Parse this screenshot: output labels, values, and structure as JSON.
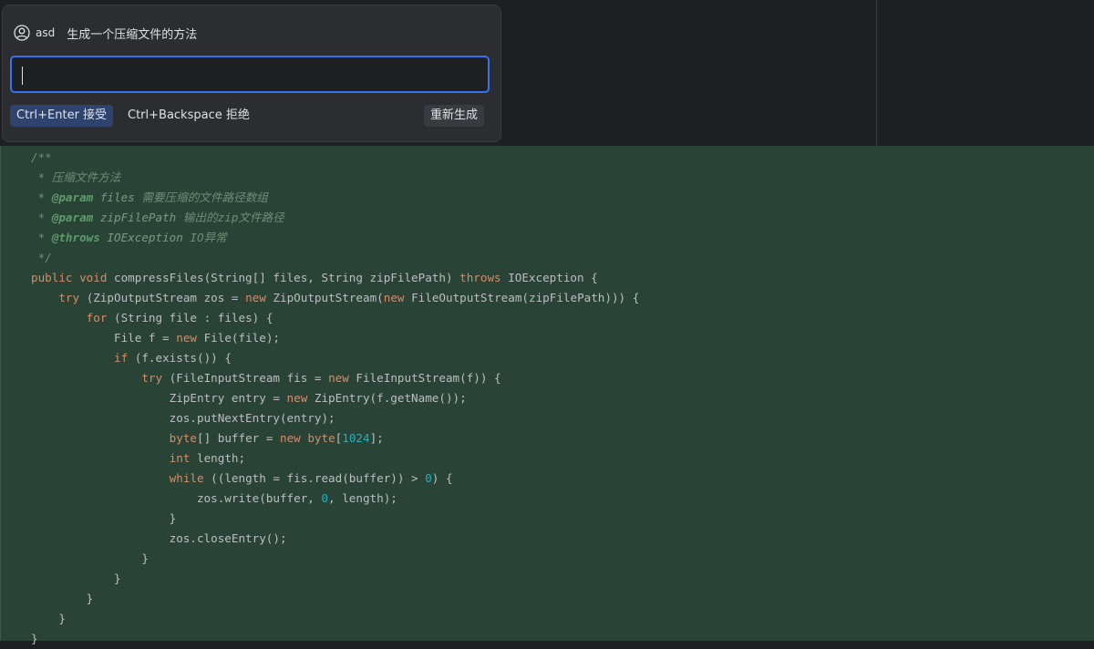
{
  "prompt": {
    "user_name": "asd",
    "text": "生成一个压缩文件的方法"
  },
  "input": {
    "value": "",
    "placeholder": ""
  },
  "actions": {
    "accept_label": "Ctrl+Enter 接受",
    "reject_label": "Ctrl+Backspace 拒绝",
    "regenerate_label": "重新生成"
  },
  "code": {
    "lines": [
      [
        [
          "c-comment",
          "/**"
        ]
      ],
      [
        [
          "c-comment",
          " * 压缩文件方法"
        ]
      ],
      [
        [
          "c-comment",
          " * "
        ],
        [
          "c-tag",
          "@param"
        ],
        [
          "c-param",
          " files "
        ],
        [
          "c-comment",
          "需要压缩的文件路径数组"
        ]
      ],
      [
        [
          "c-comment",
          " * "
        ],
        [
          "c-tag",
          "@param"
        ],
        [
          "c-param",
          " zipFilePath "
        ],
        [
          "c-comment",
          "输出的zip文件路径"
        ]
      ],
      [
        [
          "c-comment",
          " * "
        ],
        [
          "c-tag",
          "@throws"
        ],
        [
          "c-param",
          " IOException "
        ],
        [
          "c-comment",
          "IO异常"
        ]
      ],
      [
        [
          "c-comment",
          " */"
        ]
      ],
      [
        [
          "c-kw",
          "public void "
        ],
        [
          "",
          "compressFiles(String[] files, String zipFilePath) "
        ],
        [
          "c-kw",
          "throws "
        ],
        [
          "",
          "IOException {"
        ]
      ],
      [
        [
          "",
          "    "
        ],
        [
          "c-kw",
          "try "
        ],
        [
          "",
          "(ZipOutputStream zos = "
        ],
        [
          "c-kw",
          "new "
        ],
        [
          "",
          "ZipOutputStream("
        ],
        [
          "c-kw",
          "new "
        ],
        [
          "",
          "FileOutputStream(zipFilePath))) {"
        ]
      ],
      [
        [
          "",
          "        "
        ],
        [
          "c-kw",
          "for "
        ],
        [
          "",
          "(String file : files) {"
        ]
      ],
      [
        [
          "",
          "            File f = "
        ],
        [
          "c-kw",
          "new "
        ],
        [
          "",
          "File(file);"
        ]
      ],
      [
        [
          "",
          "            "
        ],
        [
          "c-kw",
          "if "
        ],
        [
          "",
          "(f.exists()) {"
        ]
      ],
      [
        [
          "",
          "                "
        ],
        [
          "c-kw",
          "try "
        ],
        [
          "",
          "(FileInputStream fis = "
        ],
        [
          "c-kw",
          "new "
        ],
        [
          "",
          "FileInputStream(f)) {"
        ]
      ],
      [
        [
          "",
          "                    ZipEntry entry = "
        ],
        [
          "c-kw",
          "new "
        ],
        [
          "",
          "ZipEntry(f.getName());"
        ]
      ],
      [
        [
          "",
          "                    zos.putNextEntry(entry);"
        ]
      ],
      [
        [
          "",
          "                    "
        ],
        [
          "c-kw",
          "byte"
        ],
        [
          "",
          "[] buffer = "
        ],
        [
          "c-kw",
          "new byte"
        ],
        [
          "",
          "["
        ],
        [
          "c-num",
          "1024"
        ],
        [
          "",
          "];"
        ]
      ],
      [
        [
          "",
          "                    "
        ],
        [
          "c-kw",
          "int "
        ],
        [
          "",
          "length;"
        ]
      ],
      [
        [
          "",
          "                    "
        ],
        [
          "c-kw",
          "while "
        ],
        [
          "",
          "((length = fis.read(buffer)) > "
        ],
        [
          "c-num",
          "0"
        ],
        [
          "",
          ") {"
        ]
      ],
      [
        [
          "",
          "                        zos.write(buffer, "
        ],
        [
          "c-num",
          "0"
        ],
        [
          "",
          ", length);"
        ]
      ],
      [
        [
          "",
          "                    }"
        ]
      ],
      [
        [
          "",
          "                    zos.closeEntry();"
        ]
      ],
      [
        [
          "",
          "                }"
        ]
      ],
      [
        [
          "",
          "            }"
        ]
      ],
      [
        [
          "",
          "        }"
        ]
      ],
      [
        [
          "",
          "    }"
        ]
      ],
      [
        [
          "",
          "}"
        ]
      ]
    ]
  }
}
